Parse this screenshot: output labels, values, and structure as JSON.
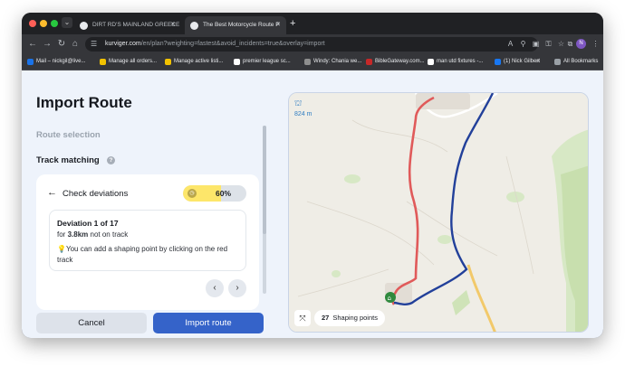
{
  "browser": {
    "tabs": [
      {
        "label": "DIRT RD'S MAINLAND GREECE"
      },
      {
        "label": "The Best Motorcycle Route P"
      }
    ],
    "new_tab": "+",
    "url_host": "kurviger.com",
    "url_rest": "/en/plan?weighting=fastest&avoid_incidents=true&overlay=import",
    "avatar_letter": "N",
    "bookmarks": [
      {
        "label": "Mail – nickgil@live...",
        "color": "#1a73e8"
      },
      {
        "label": "Manage all orders...",
        "color": "#f2c200"
      },
      {
        "label": "Manage active listi...",
        "color": "#f2c200"
      },
      {
        "label": "premier league sc...",
        "color": "#ffffff"
      },
      {
        "label": "Windy: Chania we...",
        "color": "#8e8e8e"
      },
      {
        "label": "BibleGateway.com...",
        "color": "#c62828"
      },
      {
        "label": "man utd fixtures -...",
        "color": "#ffffff"
      },
      {
        "label": "(1) Nick Gilbert",
        "color": "#1877f2"
      }
    ],
    "bookmarks_more": "»",
    "all_bookmarks": "All Bookmarks"
  },
  "panel": {
    "title": "Import Route",
    "route_selection": "Route selection",
    "track_matching": "Track matching",
    "help": "?",
    "check_deviations": "Check deviations",
    "progress_text": "60%",
    "progress_fraction": 0.6,
    "deviation_title": "Deviation 1 of 17",
    "deviation_prefix": "for",
    "deviation_distance": "3.8km",
    "deviation_suffix": "not on track",
    "deviation_hint": "You can add a shaping point by clicking on the red track",
    "cancel": "Cancel",
    "import": "Import route"
  },
  "map": {
    "elevation": "824 m",
    "shaping_count": "27",
    "shaping_label": "Shaping points",
    "track_color": "#e05a5a",
    "route_color": "#22409a"
  }
}
